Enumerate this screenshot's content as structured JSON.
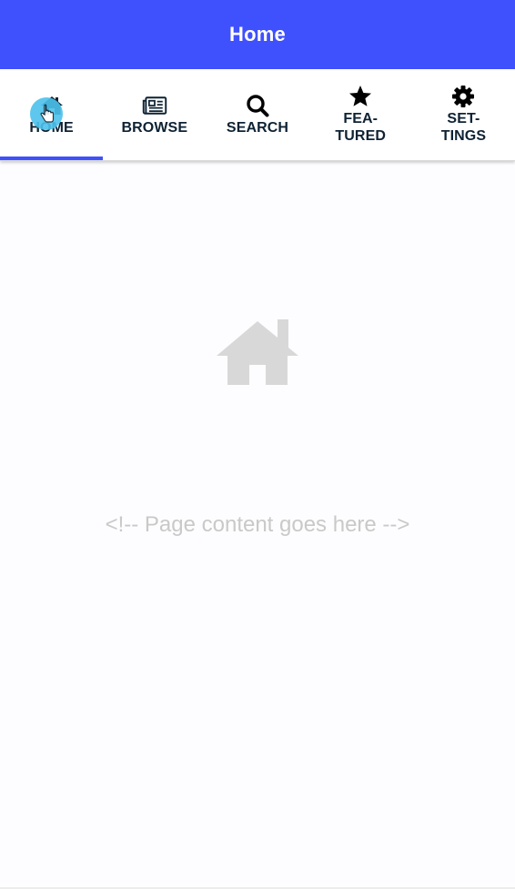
{
  "action_bar": {
    "title": "Home",
    "color": "#3f51fd"
  },
  "tabs": [
    {
      "label": "HOME",
      "icon": "home-icon",
      "active": true
    },
    {
      "label": "BROWSE",
      "icon": "newspaper-icon",
      "active": false
    },
    {
      "label": "SEARCH",
      "icon": "search-icon",
      "active": false
    },
    {
      "label": "FEA-\nTURED",
      "icon": "star-icon",
      "active": false
    },
    {
      "label": "SET-\nTINGS",
      "icon": "gear-icon",
      "active": false
    }
  ],
  "content": {
    "icon": "home-icon",
    "placeholder": "<!-- Page content goes here -->"
  },
  "colors": {
    "accent": "#3f51fd",
    "tab_text": "#0e2233",
    "placeholder": "#c9c9c9",
    "big_icon": "#d9d8d9",
    "touch": "#4cc2ec"
  }
}
